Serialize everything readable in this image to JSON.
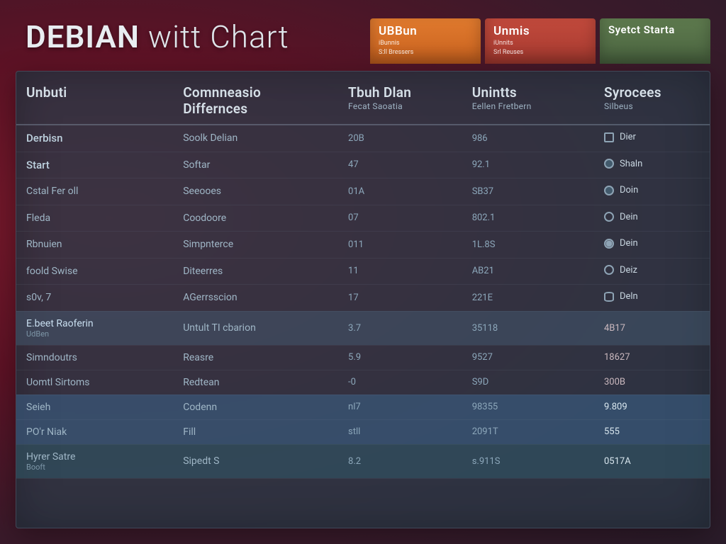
{
  "title_main": "DEBIAN",
  "title_mid": "witt",
  "title_end": "Chart",
  "tabs": [
    {
      "label": "UBBun",
      "sub1": "iBunnis",
      "sub2": "S:ll Bressers"
    },
    {
      "label": "Unmis",
      "sub1": "iUnnits",
      "sub2": "Srl Reuses"
    },
    {
      "label": "Syetct Starta",
      "sub1": "",
      "sub2": ""
    }
  ],
  "columns": [
    {
      "head": "Unbuti",
      "sub": ""
    },
    {
      "head": "Comnneasio Differnces",
      "sub": ""
    },
    {
      "head": "Tbuh Dlan",
      "sub": "Fecat Saoatia"
    },
    {
      "head": "Unintts",
      "sub": "Eellen Fretbern"
    },
    {
      "head": "Syrocees",
      "sub": "Silbeus"
    }
  ],
  "chart_data": {
    "type": "table",
    "title": "DEBIAN witt Chart",
    "columns": [
      "Unbuti",
      "Comnneasio Differnces",
      "Tbuh Dlan Fecat Saoatia",
      "Unintts Eellen Fretbern",
      "Syrocees Silbeus"
    ],
    "rows": [
      {
        "group": "intro",
        "c0": "Derbisn",
        "c1": "Soolk Delian",
        "c2": "20B",
        "c3": "986",
        "c4": "Dier",
        "icon": "square"
      },
      {
        "group": "intro",
        "c0": "Start",
        "c1": "Softar",
        "c2": "47",
        "c3": "92.1",
        "c4": "Shaln",
        "icon": "dot"
      },
      {
        "group": "body",
        "c0": "Cstal Fer oll",
        "c1": "Seeooes",
        "c2": "01A",
        "c3": "SB37",
        "c4": "Doin",
        "icon": "dot"
      },
      {
        "group": "body",
        "c0": "Fleda",
        "c1": "Coodoore",
        "c2": "07",
        "c3": "802.1",
        "c4": "Dein",
        "icon": "circle"
      },
      {
        "group": "body",
        "c0": "Rbnuien",
        "c1": "Simpnterce",
        "c2": "011",
        "c3": "1L.8S",
        "c4": "Dein",
        "icon": "disk"
      },
      {
        "group": "body",
        "c0": "foold Swise",
        "c1": "Diteerres",
        "c2": "11",
        "c3": "AB21",
        "c4": "Deiz",
        "icon": "circle"
      },
      {
        "group": "body",
        "c0": "s0v, 7",
        "c1": "AGerrsscion",
        "c2": "17",
        "c3": "221E",
        "c4": "Deln",
        "icon": "db"
      },
      {
        "group": "hl1",
        "c0": "E.beet Raoferin",
        "c0b": "UdBen",
        "c1": "Untult TI cbarion",
        "c2": "3.7",
        "c3": "35118",
        "c4": "4B17",
        "icon": ""
      },
      {
        "group": "mid",
        "c0": "Simndoutrs",
        "c1": "Reasre",
        "c2": "5.9",
        "c3": "9527",
        "c4": "18627",
        "icon": ""
      },
      {
        "group": "mid",
        "c0": "Uomtl Sirtoms",
        "c1": "Redtean",
        "c2": "-0",
        "c3": "S9D",
        "c4": "300B",
        "icon": ""
      },
      {
        "group": "hl2",
        "c0": "Seieh",
        "c1": "Codenn",
        "c2": "nl7",
        "c3": "98355",
        "c4": "9.809",
        "icon": ""
      },
      {
        "group": "hl2",
        "c0": "PO'r Niak",
        "c1": "Fill",
        "c2": "stll",
        "c3": "2091T",
        "c4": "555",
        "icon": ""
      },
      {
        "group": "foot",
        "c0": "Hyrer Satre",
        "c0b": "Booft",
        "c1": "Sipedt S",
        "c2": "8.2",
        "c3": "s.911S",
        "c4": "0517A",
        "icon": ""
      }
    ]
  }
}
